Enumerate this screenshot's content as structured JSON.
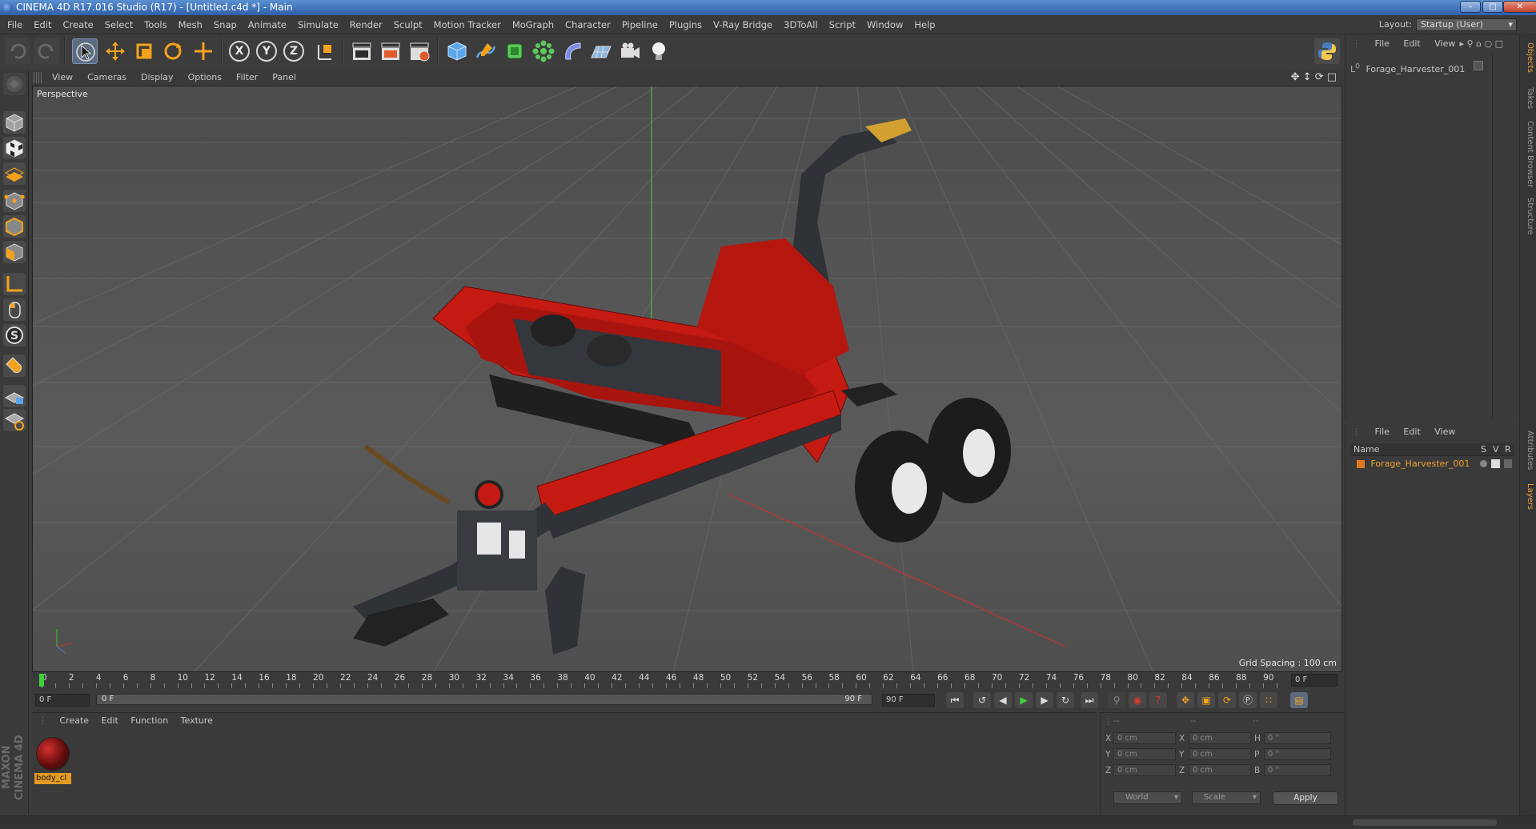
{
  "window": {
    "title": "CINEMA 4D R17.016 Studio (R17) - [Untitled.c4d *] - Main",
    "minimize": "–",
    "maximize": "□",
    "close": "✕"
  },
  "menubar": {
    "items": [
      "File",
      "Edit",
      "Create",
      "Select",
      "Tools",
      "Mesh",
      "Snap",
      "Animate",
      "Simulate",
      "Render",
      "Sculpt",
      "Motion Tracker",
      "MoGraph",
      "Character",
      "Pipeline",
      "Plugins",
      "V-Ray Bridge",
      "3DToAll",
      "Script",
      "Window",
      "Help"
    ],
    "layout_label": "Layout:",
    "layout_value": "Startup (User)"
  },
  "toolbar": {
    "axis_x": "X",
    "axis_y": "Y",
    "axis_z": "Z"
  },
  "viewport": {
    "menu": [
      "View",
      "Cameras",
      "Display",
      "Options",
      "Filter",
      "Panel"
    ],
    "camera_label": "Perspective",
    "grid_spacing": "Grid Spacing : 100 cm",
    "model_colors": {
      "body_red": "#c41a12",
      "frame_dark": "#2f3236",
      "tire": "#1c1c1c",
      "rim": "#e8e8e8"
    }
  },
  "object_manager": {
    "menu": [
      "File",
      "Edit",
      "View"
    ],
    "objects": [
      "Forage_Harvester_001"
    ]
  },
  "layer_manager": {
    "menu": [
      "File",
      "Edit",
      "View"
    ],
    "column_name": "Name",
    "column_s": "S",
    "column_v": "V",
    "column_r": "R",
    "layers": [
      "Forage_Harvester_001"
    ],
    "layer_color": "#e0771e"
  },
  "right_tabs": [
    "Objects",
    "Takes",
    "Content Browser",
    "Structure",
    "Attributes",
    "Layers"
  ],
  "timeline": {
    "ticks": [
      "0",
      "2",
      "4",
      "6",
      "8",
      "10",
      "12",
      "14",
      "16",
      "18",
      "20",
      "22",
      "24",
      "26",
      "28",
      "30",
      "32",
      "34",
      "36",
      "38",
      "40",
      "42",
      "44",
      "46",
      "48",
      "50",
      "52",
      "54",
      "56",
      "58",
      "60",
      "62",
      "64",
      "66",
      "68",
      "70",
      "72",
      "74",
      "76",
      "78",
      "80",
      "82",
      "84",
      "86",
      "88",
      "90"
    ],
    "current_frame": "0 F",
    "start_field": "0 F",
    "slider_start": "0 F",
    "slider_end": "90 F",
    "end_field": "90 F"
  },
  "material_manager": {
    "menu": [
      "Create",
      "Edit",
      "Function",
      "Texture"
    ],
    "materials": [
      "body_cl"
    ]
  },
  "coordinates": {
    "header": [
      "--",
      "--",
      "--"
    ],
    "rows": [
      {
        "l1": "X",
        "v1": "0 cm",
        "l2": "X",
        "v2": "0 cm",
        "l3": "H",
        "v3": "0 °"
      },
      {
        "l1": "Y",
        "v1": "0 cm",
        "l2": "Y",
        "v2": "0 cm",
        "l3": "P",
        "v3": "0 °"
      },
      {
        "l1": "Z",
        "v1": "0 cm",
        "l2": "Z",
        "v2": "0 cm",
        "l3": "B",
        "v3": "0 °"
      }
    ],
    "mode_world": "World",
    "mode_scale": "Scale",
    "apply": "Apply"
  },
  "brand": "MAXON CINEMA 4D"
}
